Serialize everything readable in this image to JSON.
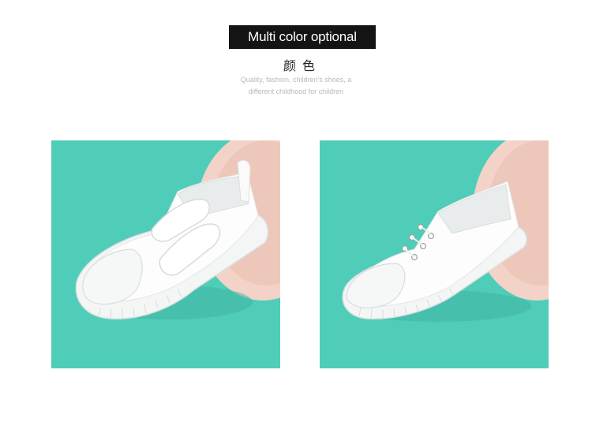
{
  "header": {
    "banner_label": "Multi color optional",
    "cn_title": "颜色",
    "tagline_line1": "Quality, fashion, children's shoes, a",
    "tagline_line2": "different childhood for children"
  },
  "products": [
    {
      "image": "white-velcro-canvas-shoe"
    },
    {
      "image": "white-lace-canvas-shoe"
    }
  ],
  "colors": {
    "banner_bg": "#141414",
    "photo_bg": "#4fcdb9",
    "plate": "#f1cfc4",
    "shoe": "#fdfdfd"
  }
}
